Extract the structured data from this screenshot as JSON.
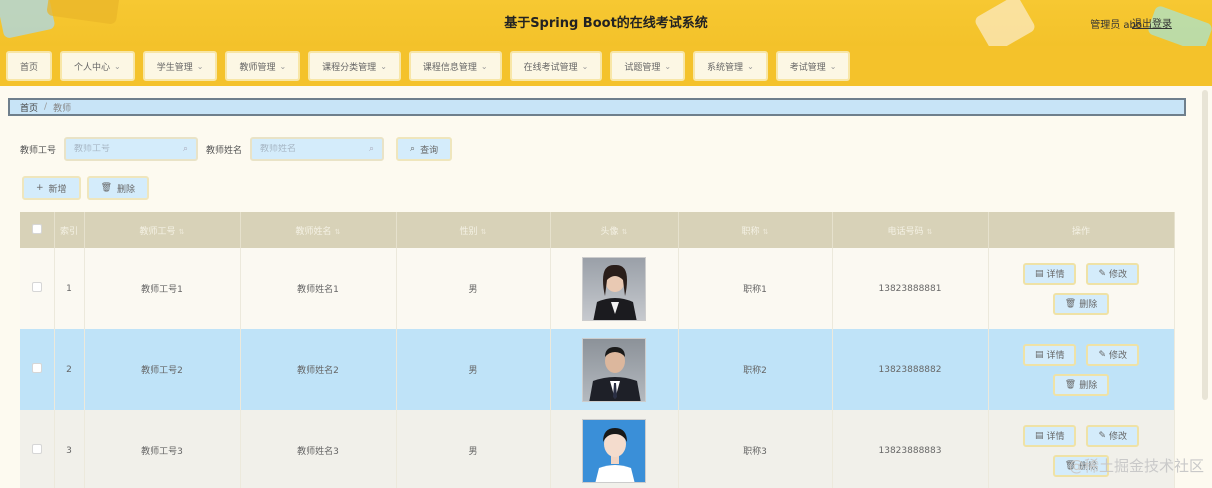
{
  "header": {
    "title": "基于Spring Boot的在线考试系统",
    "user": "管理员 abo",
    "logout": "退出登录"
  },
  "nav": {
    "items": [
      {
        "label": "首页",
        "has_menu": false
      },
      {
        "label": "个人中心",
        "has_menu": true
      },
      {
        "label": "学生管理",
        "has_menu": true
      },
      {
        "label": "教师管理",
        "has_menu": true
      },
      {
        "label": "课程分类管理",
        "has_menu": true
      },
      {
        "label": "课程信息管理",
        "has_menu": true
      },
      {
        "label": "在线考试管理",
        "has_menu": true
      },
      {
        "label": "试题管理",
        "has_menu": true
      },
      {
        "label": "系统管理",
        "has_menu": true
      },
      {
        "label": "考试管理",
        "has_menu": true
      }
    ]
  },
  "breadcrumb": {
    "home": "首页",
    "separator": "/",
    "current": "教师"
  },
  "search": {
    "label1": "教师工号",
    "placeholder1": "教师工号",
    "label2": "教师姓名",
    "placeholder2": "教师姓名",
    "button": "查询"
  },
  "actions": {
    "add": "新增",
    "delete": "删除"
  },
  "table": {
    "headers": [
      "索引",
      "教师工号",
      "教师姓名",
      "性别",
      "头像",
      "职称",
      "电话号码",
      "操作"
    ],
    "rows": [
      {
        "index": "1",
        "id": "教师工号1",
        "name": "教师姓名1",
        "gender": "男",
        "title": "职称1",
        "phone": "13823888881"
      },
      {
        "index": "2",
        "id": "教师工号2",
        "name": "教师姓名2",
        "gender": "男",
        "title": "职称2",
        "phone": "13823888882"
      },
      {
        "index": "3",
        "id": "教师工号3",
        "name": "教师姓名3",
        "gender": "男",
        "title": "职称3",
        "phone": "13823888883"
      }
    ],
    "ops": {
      "detail": "详情",
      "edit": "修改",
      "delete": "删除"
    }
  },
  "watermark": "@稀土掘金技术社区",
  "colors": {
    "header": "#f4c22b",
    "button_bg": "#d4ecfb",
    "highlight_row": "#bfe3f8",
    "table_head": "#d8d2b8"
  }
}
